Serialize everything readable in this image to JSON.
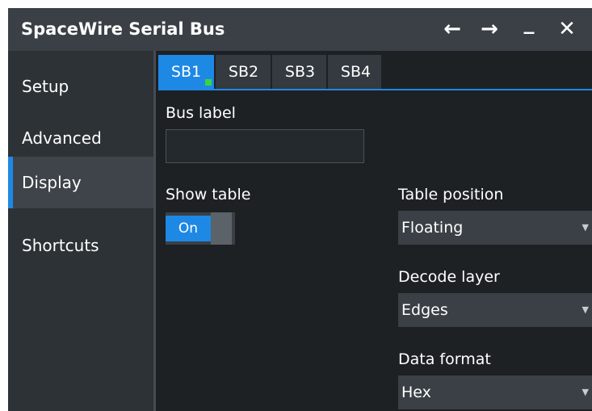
{
  "window": {
    "title": "SpaceWire Serial Bus",
    "controls": {
      "back": "←",
      "forward": "→",
      "minimize": "_",
      "close": "✕"
    }
  },
  "sidebar": {
    "items": [
      {
        "label": "Setup"
      },
      {
        "label": "Advanced"
      },
      {
        "label": "Display",
        "active": true
      },
      {
        "label": "Shortcuts"
      }
    ]
  },
  "tabs": [
    {
      "label": "SB1",
      "active": true
    },
    {
      "label": "SB2"
    },
    {
      "label": "SB3"
    },
    {
      "label": "SB4"
    }
  ],
  "bus_label": {
    "label": "Bus label",
    "value": ""
  },
  "show_table": {
    "label": "Show table",
    "state": "On"
  },
  "table_position": {
    "label": "Table position",
    "value": "Floating"
  },
  "decode_layer": {
    "label": "Decode layer",
    "value": "Edges"
  },
  "data_format": {
    "label": "Data format",
    "value": "Hex"
  },
  "colors": {
    "accent": "#1e88e5",
    "indicator": "#37d63f",
    "background": "#1d2124"
  }
}
